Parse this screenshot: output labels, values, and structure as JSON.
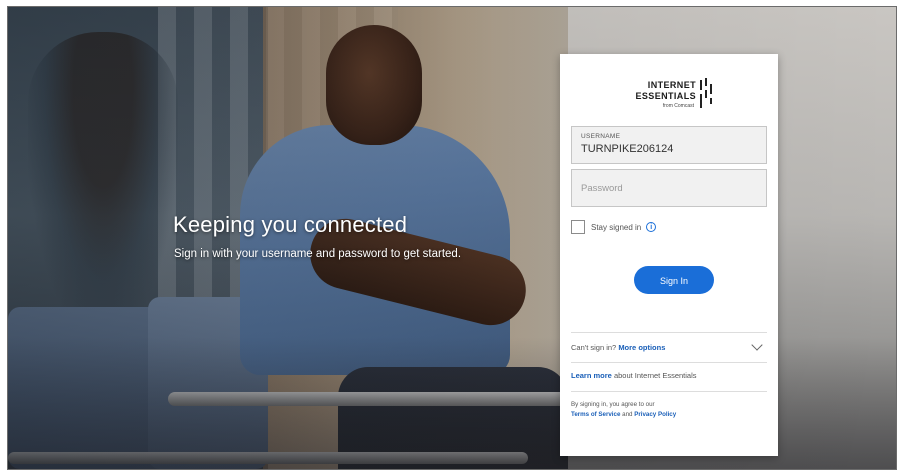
{
  "hero": {
    "title": "Keeping you connected",
    "subtitle": "Sign in with your username and password to get started."
  },
  "logo": {
    "line1": "INTERNET",
    "line2": "ESSENTIALS",
    "line3": "from Comcast"
  },
  "login": {
    "username_label": "USERNAME",
    "username_value": "TURNPIKE206124",
    "password_placeholder": "Password",
    "stay_signed_in": "Stay signed in",
    "info_glyph": "i",
    "sign_in_label": "Sign In",
    "cant_sign_in": "Can't sign in?",
    "more_options": "More options",
    "learn_more": "Learn more",
    "learn_more_suffix": "about Internet Essentials",
    "terms_line1": "By signing in, you agree to our",
    "terms_of_service": "Terms of Service",
    "terms_and": "and",
    "privacy_policy": "Privacy Policy"
  },
  "colors": {
    "accent": "#1a6ed8",
    "link": "#1a5fb8"
  }
}
